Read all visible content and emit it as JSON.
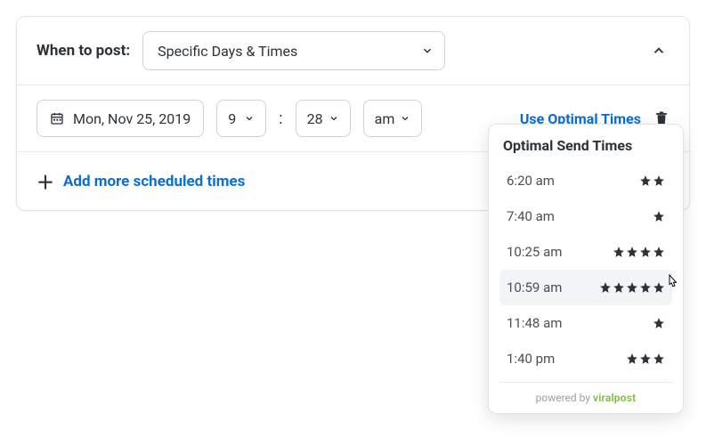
{
  "header": {
    "label": "When to post:",
    "schedule_mode": "Specific Days & Times"
  },
  "schedule": {
    "date": "Mon, Nov 25, 2019",
    "hour": "9",
    "minute": "28",
    "ampm": "am",
    "use_optimal_label": "Use Optimal Times"
  },
  "add_more_label": "Add more scheduled times",
  "popover": {
    "title": "Optimal Send Times",
    "items": [
      {
        "time": "6:20 am",
        "stars": 2,
        "hovered": false
      },
      {
        "time": "7:40 am",
        "stars": 1,
        "hovered": false
      },
      {
        "time": "10:25 am",
        "stars": 4,
        "hovered": false
      },
      {
        "time": "10:59 am",
        "stars": 5,
        "hovered": true
      },
      {
        "time": "11:48 am",
        "stars": 1,
        "hovered": false
      },
      {
        "time": "1:40 pm",
        "stars": 3,
        "hovered": false
      }
    ],
    "footer_prefix": "powered by ",
    "footer_brand": "viralpost"
  }
}
